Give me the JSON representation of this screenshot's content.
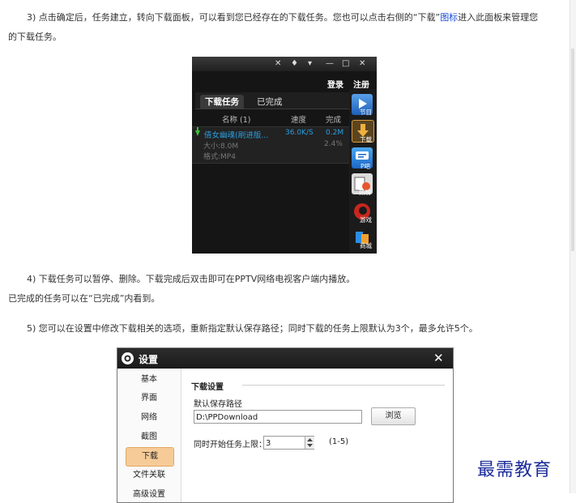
{
  "article": {
    "p3_part1": "3) 点击确定后，任务建立，转向下载面板，可以看到您已经存在的下载任务。您也可以点击右侧的“下载”",
    "p3_link": "图标",
    "p3_part2": "进入此面板来管理您",
    "p3_line2": "的下载任务。",
    "p4_line1": "4) 下载任务可以暂停、删除。下载完成后双击即可在PPTV网络电视客户端内播放。",
    "p4_line2": "已完成的任务可以在“已完成”内看到。",
    "p5": "5) 您可以在设置中修改下载相关的选项，重新指定默认保存路径；同时下载的任务上限默认为3个，最多允许5个。"
  },
  "pptv_panel": {
    "window_controls": [
      "✕",
      "ᵀ",
      "▾",
      "—",
      "□",
      "✕"
    ],
    "login": "登录",
    "register": "注册",
    "tabs": [
      "下载任务",
      "已完成"
    ],
    "columns": {
      "name": "名称 (1)",
      "speed": "速度",
      "done": "完成"
    },
    "task": {
      "name": "倩女幽魂(刷进版...",
      "speed": "36.0K/S",
      "size_done": "0.2M",
      "size": "大小:8.0M",
      "percent": "2.4%",
      "format": "格式:MP4",
      "status_color": "#3bc03b"
    },
    "sidebar": [
      "节目",
      "下载",
      "P吧",
      "热榜",
      "游戏",
      "商城"
    ]
  },
  "settings_dialog": {
    "title": "设置",
    "close": "✕",
    "nav": [
      "基本",
      "界面",
      "网络",
      "截图",
      "下载",
      "文件关联",
      "高级设置"
    ],
    "active_nav": "下载",
    "section_title": "下载设置",
    "path_label": "默认保存路径",
    "path_value": "D:\\PPDownload",
    "browse": "浏览",
    "limit_label": "同时开始任务上限：",
    "limit_value": "3",
    "limit_range": "(1-5)"
  },
  "watermark": "最需教育",
  "colors": {
    "link": "#1a4fd6",
    "accent": "#f6cb98",
    "watermark": "#1c2c9a"
  }
}
